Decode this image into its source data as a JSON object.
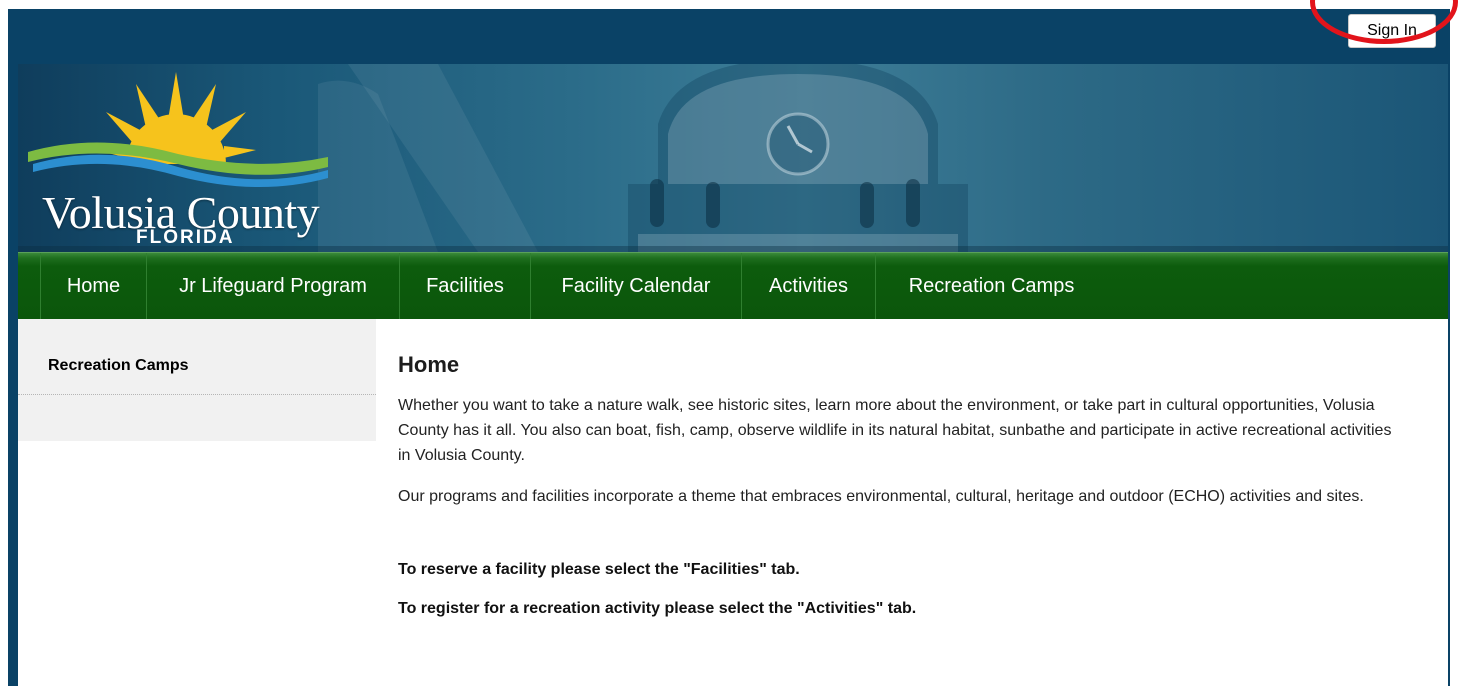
{
  "header": {
    "sign_in_label": "Sign In"
  },
  "logo": {
    "title": "Volusia County",
    "subtitle": "FLORIDA"
  },
  "nav": {
    "items": [
      {
        "label": "Home"
      },
      {
        "label": "Jr Lifeguard Program"
      },
      {
        "label": "Facilities"
      },
      {
        "label": "Facility Calendar"
      },
      {
        "label": "Activities"
      },
      {
        "label": "Recreation Camps"
      }
    ]
  },
  "sidebar": {
    "items": [
      {
        "label": "Recreation Camps"
      }
    ]
  },
  "main": {
    "title": "Home",
    "paragraphs": [
      "Whether you want to take a nature walk, see historic sites, learn more about the environment, or take part in cultural opportunities, Volusia County has it all. You also can boat, fish, camp, observe wildlife in its natural habitat, sunbathe and participate in active recreational activities in Volusia County.",
      "Our programs and facilities incorporate a theme that embraces environmental, cultural, heritage and outdoor (ECHO) activities and sites.",
      "To reserve a facility please select the \"Facilities\" tab.",
      "To register for a recreation activity please select the \"Activities\" tab."
    ]
  },
  "colors": {
    "header_bg": "#0a4266",
    "nav_bg": "#0b560b",
    "highlight_ring": "#e2141b",
    "logo_sun": "#f6c31c",
    "logo_wave_green": "#7dbb42",
    "logo_wave_blue": "#2c8fd0"
  }
}
